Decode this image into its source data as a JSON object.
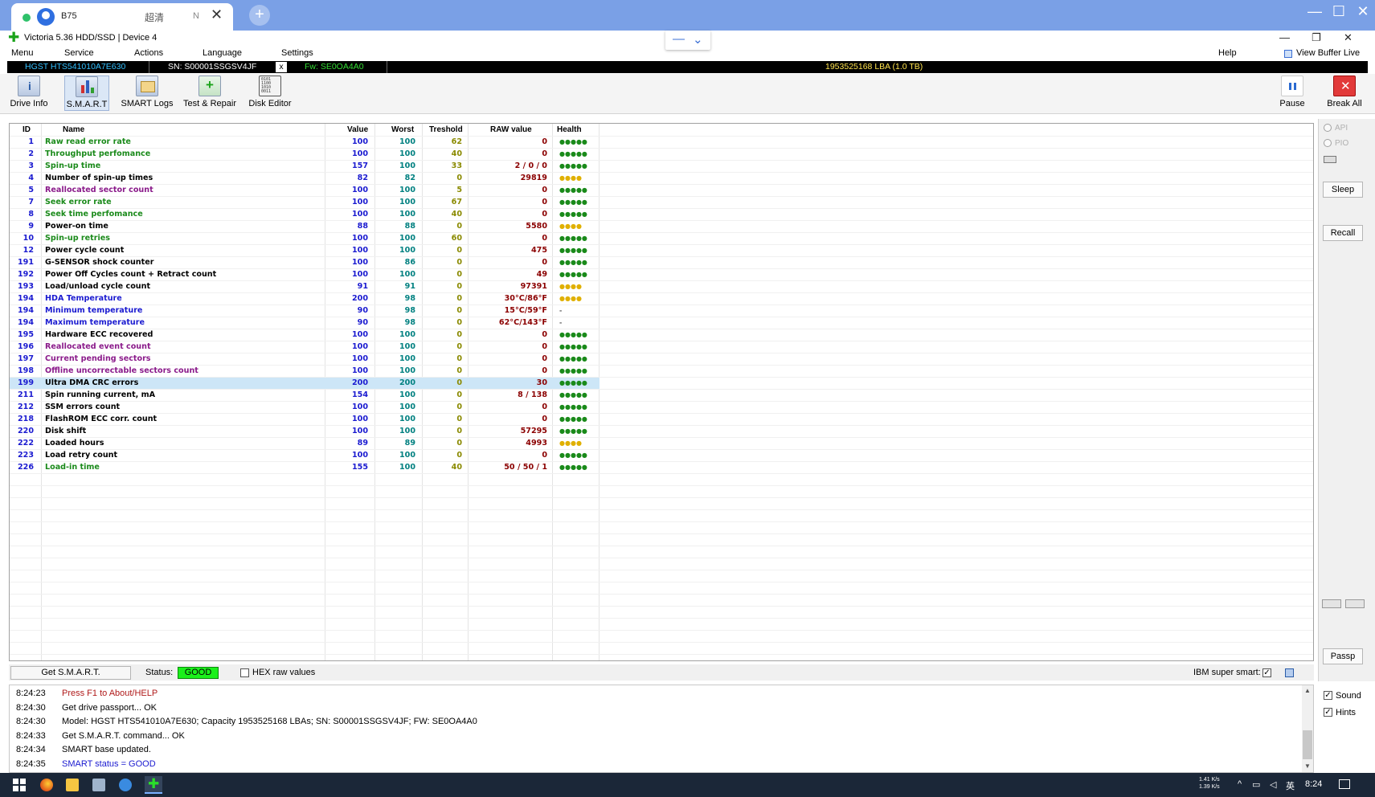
{
  "browser": {
    "tab_title": "B75",
    "tab_quality": "超清",
    "tab_n": "N",
    "close_glyph": "✕",
    "new_tab_glyph": "+",
    "win_min": "—",
    "win_max": "☐",
    "win_close": "✕"
  },
  "app": {
    "title": "Victoria 5.36 HDD/SSD | Device 4",
    "win_min": "—",
    "win_max": "❐",
    "win_close": "✕"
  },
  "menu": {
    "items": [
      "Menu",
      "Service",
      "Actions",
      "Language",
      "Settings"
    ],
    "help": "Help",
    "view_buffer": "View Buffer Live"
  },
  "drive": {
    "model": "HGST HTS541010A7E630",
    "serial": "SN: S00001SSGSV4JF",
    "x_label": "x",
    "firmware": "Fw: SE0OA4A0",
    "capacity": "1953525168 LBA (1.0 TB)"
  },
  "toolbar": {
    "drive_info": "Drive Info",
    "smart": "S.M.A.R.T",
    "smart_logs": "SMART Logs",
    "test_repair": "Test & Repair",
    "disk_editor": "Disk Editor",
    "pause": "Pause",
    "break_all": "Break All"
  },
  "smart_table": {
    "headers": {
      "id": "ID",
      "name": "Name",
      "value": "Value",
      "worst": "Worst",
      "threshold": "Treshold",
      "raw": "RAW value",
      "health": "Health"
    },
    "rows": [
      {
        "id": "1",
        "name": "Raw read error rate",
        "value": "100",
        "worst": "100",
        "threshold": "62",
        "raw": "0",
        "health": "●●●●●",
        "name_color": "#1a8a1a",
        "health_color": "#1a8a1a"
      },
      {
        "id": "2",
        "name": "Throughput perfomance",
        "value": "100",
        "worst": "100",
        "threshold": "40",
        "raw": "0",
        "health": "●●●●●",
        "name_color": "#1a8a1a",
        "health_color": "#1a8a1a"
      },
      {
        "id": "3",
        "name": "Spin-up time",
        "value": "157",
        "worst": "100",
        "threshold": "33",
        "raw": "2 / 0 / 0",
        "health": "●●●●●",
        "name_color": "#1a8a1a",
        "health_color": "#1a8a1a"
      },
      {
        "id": "4",
        "name": "Number of spin-up times",
        "value": "82",
        "worst": "82",
        "threshold": "0",
        "raw": "29819",
        "health": "●●●●",
        "name_color": "#000000",
        "health_color": "#e0b000"
      },
      {
        "id": "5",
        "name": "Reallocated sector count",
        "value": "100",
        "worst": "100",
        "threshold": "5",
        "raw": "0",
        "health": "●●●●●",
        "name_color": "#8a1a8a",
        "health_color": "#1a8a1a"
      },
      {
        "id": "7",
        "name": "Seek error rate",
        "value": "100",
        "worst": "100",
        "threshold": "67",
        "raw": "0",
        "health": "●●●●●",
        "name_color": "#1a8a1a",
        "health_color": "#1a8a1a"
      },
      {
        "id": "8",
        "name": "Seek time perfomance",
        "value": "100",
        "worst": "100",
        "threshold": "40",
        "raw": "0",
        "health": "●●●●●",
        "name_color": "#1a8a1a",
        "health_color": "#1a8a1a"
      },
      {
        "id": "9",
        "name": "Power-on time",
        "value": "88",
        "worst": "88",
        "threshold": "0",
        "raw": "5580",
        "health": "●●●●",
        "name_color": "#000000",
        "health_color": "#e0b000"
      },
      {
        "id": "10",
        "name": "Spin-up retries",
        "value": "100",
        "worst": "100",
        "threshold": "60",
        "raw": "0",
        "health": "●●●●●",
        "name_color": "#1a8a1a",
        "health_color": "#1a8a1a"
      },
      {
        "id": "12",
        "name": "Power cycle count",
        "value": "100",
        "worst": "100",
        "threshold": "0",
        "raw": "475",
        "health": "●●●●●",
        "name_color": "#000000",
        "health_color": "#1a8a1a"
      },
      {
        "id": "191",
        "name": "G-SENSOR shock counter",
        "value": "100",
        "worst": "86",
        "threshold": "0",
        "raw": "0",
        "health": "●●●●●",
        "name_color": "#000000",
        "health_color": "#1a8a1a"
      },
      {
        "id": "192",
        "name": "Power Off Cycles count + Retract count",
        "value": "100",
        "worst": "100",
        "threshold": "0",
        "raw": "49",
        "health": "●●●●●",
        "name_color": "#000000",
        "health_color": "#1a8a1a"
      },
      {
        "id": "193",
        "name": "Load/unload cycle count",
        "value": "91",
        "worst": "91",
        "threshold": "0",
        "raw": "97391",
        "health": "●●●●",
        "name_color": "#000000",
        "health_color": "#e0b000"
      },
      {
        "id": "194",
        "name": "HDA Temperature",
        "value": "200",
        "worst": "98",
        "threshold": "0",
        "raw": "30°C/86°F",
        "health": "●●●●",
        "name_color": "#1a1ad0",
        "health_color": "#e0b000"
      },
      {
        "id": "194",
        "name": "Minimum temperature",
        "value": "90",
        "worst": "98",
        "threshold": "0",
        "raw": "15°C/59°F",
        "health": "-",
        "name_color": "#1a1ad0",
        "health_color": "#555555"
      },
      {
        "id": "194",
        "name": "Maximum temperature",
        "value": "90",
        "worst": "98",
        "threshold": "0",
        "raw": "62°C/143°F",
        "health": "-",
        "name_color": "#1a1ad0",
        "health_color": "#555555"
      },
      {
        "id": "195",
        "name": "Hardware ECC recovered",
        "value": "100",
        "worst": "100",
        "threshold": "0",
        "raw": "0",
        "health": "●●●●●",
        "name_color": "#000000",
        "health_color": "#1a8a1a"
      },
      {
        "id": "196",
        "name": "Reallocated event count",
        "value": "100",
        "worst": "100",
        "threshold": "0",
        "raw": "0",
        "health": "●●●●●",
        "name_color": "#8a1a8a",
        "health_color": "#1a8a1a"
      },
      {
        "id": "197",
        "name": "Current pending sectors",
        "value": "100",
        "worst": "100",
        "threshold": "0",
        "raw": "0",
        "health": "●●●●●",
        "name_color": "#8a1a8a",
        "health_color": "#1a8a1a"
      },
      {
        "id": "198",
        "name": "Offline uncorrectable sectors count",
        "value": "100",
        "worst": "100",
        "threshold": "0",
        "raw": "0",
        "health": "●●●●●",
        "name_color": "#8a1a8a",
        "health_color": "#1a8a1a"
      },
      {
        "id": "199",
        "name": "Ultra DMA CRC errors",
        "value": "200",
        "worst": "200",
        "threshold": "0",
        "raw": "30",
        "health": "●●●●●",
        "name_color": "#000000",
        "health_color": "#1a8a1a",
        "selected": true
      },
      {
        "id": "211",
        "name": "Spin running current, mA",
        "value": "154",
        "worst": "100",
        "threshold": "0",
        "raw": "8 / 138",
        "health": "●●●●●",
        "name_color": "#000000",
        "health_color": "#1a8a1a"
      },
      {
        "id": "212",
        "name": "SSM errors count",
        "value": "100",
        "worst": "100",
        "threshold": "0",
        "raw": "0",
        "health": "●●●●●",
        "name_color": "#000000",
        "health_color": "#1a8a1a"
      },
      {
        "id": "218",
        "name": "FlashROM ECC corr. count",
        "value": "100",
        "worst": "100",
        "threshold": "0",
        "raw": "0",
        "health": "●●●●●",
        "name_color": "#000000",
        "health_color": "#1a8a1a"
      },
      {
        "id": "220",
        "name": "Disk shift",
        "value": "100",
        "worst": "100",
        "threshold": "0",
        "raw": "57295",
        "health": "●●●●●",
        "name_color": "#000000",
        "health_color": "#1a8a1a"
      },
      {
        "id": "222",
        "name": "Loaded hours",
        "value": "89",
        "worst": "89",
        "threshold": "0",
        "raw": "4993",
        "health": "●●●●",
        "name_color": "#000000",
        "health_color": "#e0b000"
      },
      {
        "id": "223",
        "name": "Load retry count",
        "value": "100",
        "worst": "100",
        "threshold": "0",
        "raw": "0",
        "health": "●●●●●",
        "name_color": "#000000",
        "health_color": "#1a8a1a"
      },
      {
        "id": "226",
        "name": "Load-in time",
        "value": "155",
        "worst": "100",
        "threshold": "40",
        "raw": "50 / 50 / 1",
        "health": "●●●●●",
        "name_color": "#1a8a1a",
        "health_color": "#1a8a1a"
      }
    ]
  },
  "side_panel": {
    "api": "API",
    "pio": "PIO",
    "sleep": "Sleep",
    "recall": "Recall",
    "passp": "Passp",
    "sound": "Sound",
    "hints": "Hints"
  },
  "status_bar": {
    "get_smart": "Get S.M.A.R.T.",
    "status_label": "Status:",
    "status_value": "GOOD",
    "hex_raw": "HEX raw values",
    "ibm_super_smart": "IBM super smart:",
    "check_glyph": "✓"
  },
  "log": [
    {
      "time": "8:24:23",
      "text": "Press F1 to About/HELP",
      "color": "#b01a1a"
    },
    {
      "time": "8:24:30",
      "text": "Get drive passport... OK",
      "color": "#000000"
    },
    {
      "time": "8:24:30",
      "text": "Model: HGST HTS541010A7E630; Capacity 1953525168 LBAs; SN: S00001SSGSV4JF; FW: SE0OA4A0",
      "color": "#000000"
    },
    {
      "time": "8:24:33",
      "text": "Get S.M.A.R.T. command... OK",
      "color": "#000000"
    },
    {
      "time": "8:24:34",
      "text": "SMART base updated.",
      "color": "#000000"
    },
    {
      "time": "8:24:35",
      "text": "SMART status = GOOD",
      "color": "#1a1ad0"
    }
  ],
  "taskbar": {
    "net_up": "1.41 K/s",
    "net_down": "1.39 K/s",
    "ime": "英",
    "time": "8:24"
  },
  "colors": {
    "value": "#1a1ad0",
    "worst": "#008080",
    "threshold": "#8a8a00",
    "raw": "#8b0000",
    "drive_model": "#33c0ff",
    "drive_serial": "#ffffff",
    "drive_fw": "#33dd33",
    "drive_capacity": "#ffe34d"
  }
}
